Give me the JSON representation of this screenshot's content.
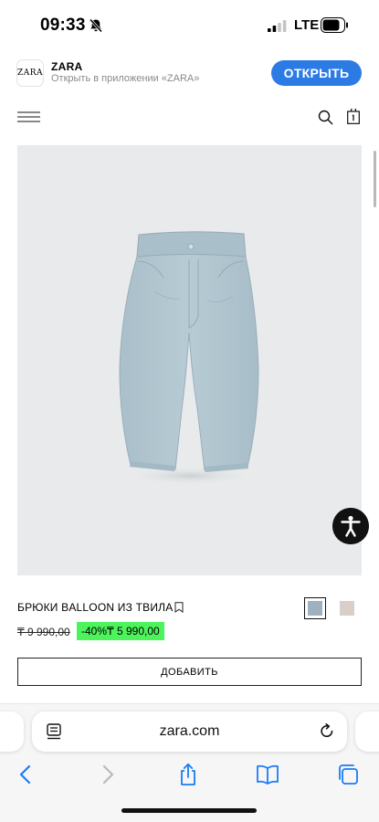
{
  "status": {
    "time": "09:33",
    "network": "LTE"
  },
  "app_banner": {
    "icon_text": "ZARA",
    "name": "ZARA",
    "subtitle": "Открыть в приложении «ZARA»",
    "open_label": "ОТКРЫТЬ",
    "accent": "#2c7be5"
  },
  "product": {
    "title": "БРЮКИ BALLOON ИЗ ТВИЛА",
    "old_price": "₸ 9 990,00",
    "discount": "-40%",
    "new_price": "₸ 5 990,00",
    "discount_color": "#4cf35a",
    "add_label": "ДОБАВИТЬ",
    "colors": [
      "#9fb1bf",
      "#d9cfc8"
    ]
  },
  "browser": {
    "url": "zara.com"
  }
}
